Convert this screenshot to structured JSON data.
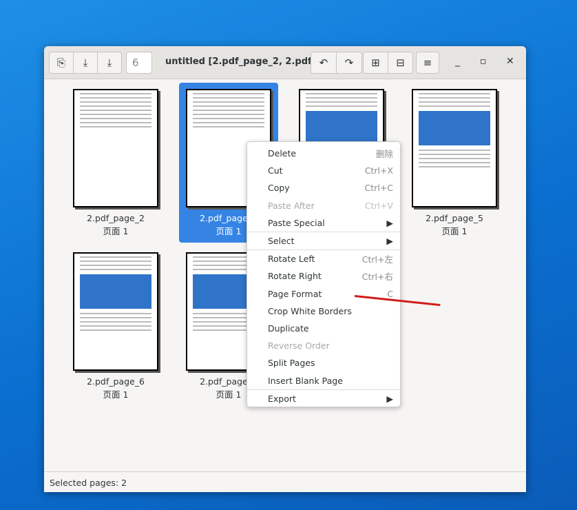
{
  "window": {
    "title": "untitled [2.pdf_page_2, 2.pdf_...",
    "page_count": "6"
  },
  "toolbar": {
    "icons": [
      "import-icon",
      "save-icon",
      "save-as-icon",
      "rotate-left-icon",
      "rotate-right-icon",
      "zoom-in-icon",
      "zoom-out-icon",
      "menu-icon"
    ]
  },
  "pages": [
    {
      "name": "2.pdf_page_2",
      "sub": "页面 1",
      "selected": false
    },
    {
      "name": "2.pdf_page_3",
      "sub": "页面 1",
      "selected": true
    },
    {
      "name": "",
      "sub": "",
      "selected": false
    },
    {
      "name": "2.pdf_page_5",
      "sub": "页面 1",
      "selected": false
    },
    {
      "name": "2.pdf_page_6",
      "sub": "页面 1",
      "selected": false
    },
    {
      "name": "2.pdf_page_7",
      "sub": "页面 1",
      "selected": false
    }
  ],
  "status": "Selected pages: 2",
  "menu": [
    {
      "label": "Delete",
      "shortcut": "删除"
    },
    {
      "label": "Cut",
      "shortcut": "Ctrl+X"
    },
    {
      "label": "Copy",
      "shortcut": "Ctrl+C"
    },
    {
      "label": "Paste After",
      "shortcut": "Ctrl+V",
      "disabled": true
    },
    {
      "label": "Paste Special",
      "shortcut": "▶"
    },
    {
      "label": "Select",
      "shortcut": "▶"
    },
    {
      "label": "Rotate Left",
      "shortcut": "Ctrl+左"
    },
    {
      "label": "Rotate Right",
      "shortcut": "Ctrl+右"
    },
    {
      "label": "Page Format",
      "shortcut": "C"
    },
    {
      "label": "Crop White Borders",
      "shortcut": ""
    },
    {
      "label": "Duplicate",
      "shortcut": ""
    },
    {
      "label": "Reverse Order",
      "shortcut": "",
      "disabled": true
    },
    {
      "label": "Split Pages",
      "shortcut": ""
    },
    {
      "label": "Insert Blank Page",
      "shortcut": ""
    },
    {
      "label": "Export",
      "shortcut": "▶"
    }
  ],
  "colors": {
    "selection": "#3584e4",
    "annotation_arrow": "#d31b1b"
  }
}
